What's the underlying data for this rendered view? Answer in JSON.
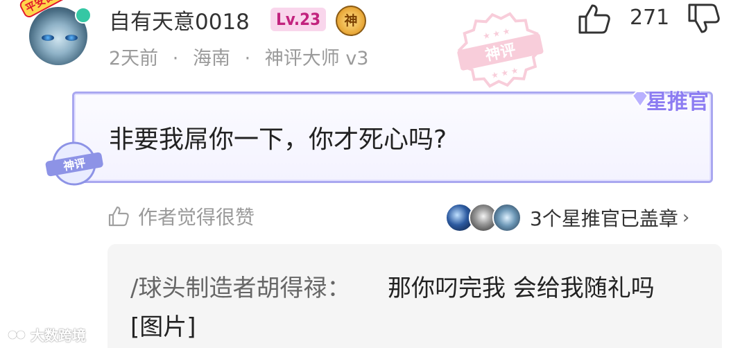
{
  "user": {
    "avatar_frame_text": "平安健康",
    "name": "自有天意0018",
    "level": "Lv.23",
    "medal": "神",
    "time": "2天前",
    "location": "海南",
    "title": "神评大师 v3",
    "separator": "·"
  },
  "votes": {
    "like_count": "271",
    "like_icon": "thumbs-up-icon",
    "dislike_icon": "thumbs-down-icon"
  },
  "stamps": {
    "big_stamp_text": "神评",
    "small_stamp_text": "神评"
  },
  "comment": {
    "text": "非要我屌你一下，你才死心吗?",
    "badge": "星推官"
  },
  "author_like": {
    "text": "作者觉得很赞"
  },
  "sealers": {
    "text": "3个星推官已盖章",
    "chevron": "›"
  },
  "reply": {
    "author": "/球头制造者胡得禄：",
    "text": "那你叼完我 会给我随礼吗",
    "image_placeholder": "[图片]"
  },
  "watermark": {
    "text": "大数跨境"
  },
  "colors": {
    "accent_purple": "#8c7cf2",
    "stamp_pink": "#f3a6bd",
    "level_pink": "#c2237e",
    "online_green": "#35c7a4"
  }
}
